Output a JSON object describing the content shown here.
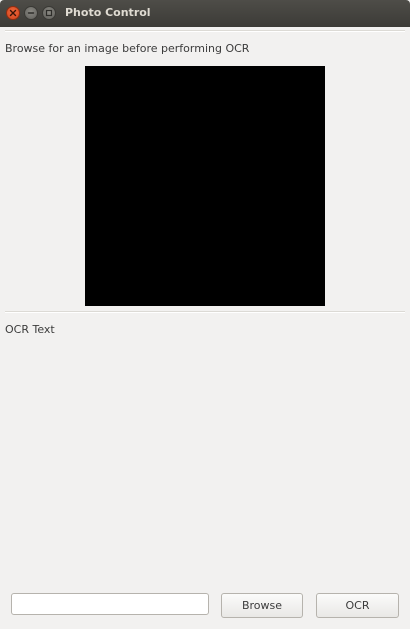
{
  "window": {
    "title": "Photo Control"
  },
  "main": {
    "browse_hint": "Browse for an image before performing OCR",
    "ocr_text_label": "OCR Text"
  },
  "controls": {
    "path_value": "",
    "browse_label": "Browse",
    "ocr_label": "OCR"
  },
  "colors": {
    "titlebar": "#3c3b37",
    "close_button": "#e05a2b",
    "preview_background": "#000000",
    "window_background": "#f2f1f0"
  },
  "icons": {
    "close": "close-icon",
    "minimize": "minimize-icon",
    "maximize": "maximize-icon"
  }
}
